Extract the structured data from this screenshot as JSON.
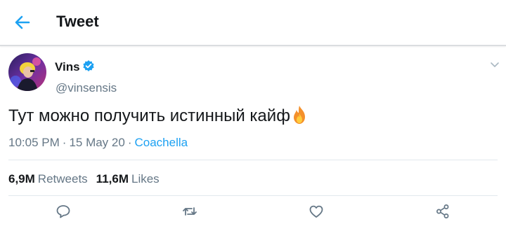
{
  "header": {
    "title": "Tweet"
  },
  "tweet": {
    "author": {
      "display_name": "Vins",
      "handle": "@vinsensis",
      "verified": true
    },
    "text": "Тут можно получить истинный кайф",
    "emoji": "fire",
    "time": "10:05 PM",
    "date": "15 May 20",
    "place": "Coachella",
    "separator": "·",
    "stats": {
      "retweets_count": "6,9M",
      "retweets_label": "Retweets",
      "likes_count": "11,6M",
      "likes_label": "Likes"
    }
  },
  "icons": {
    "back": "back-arrow-icon",
    "verified": "verified-badge-icon",
    "more": "chevron-down-icon",
    "reply": "reply-icon",
    "retweet": "retweet-icon",
    "like": "heart-icon",
    "share": "share-icon"
  },
  "colors": {
    "accent": "#1da1f2",
    "text": "#14171a",
    "secondary": "#657786",
    "divider": "#e1e8ed"
  }
}
